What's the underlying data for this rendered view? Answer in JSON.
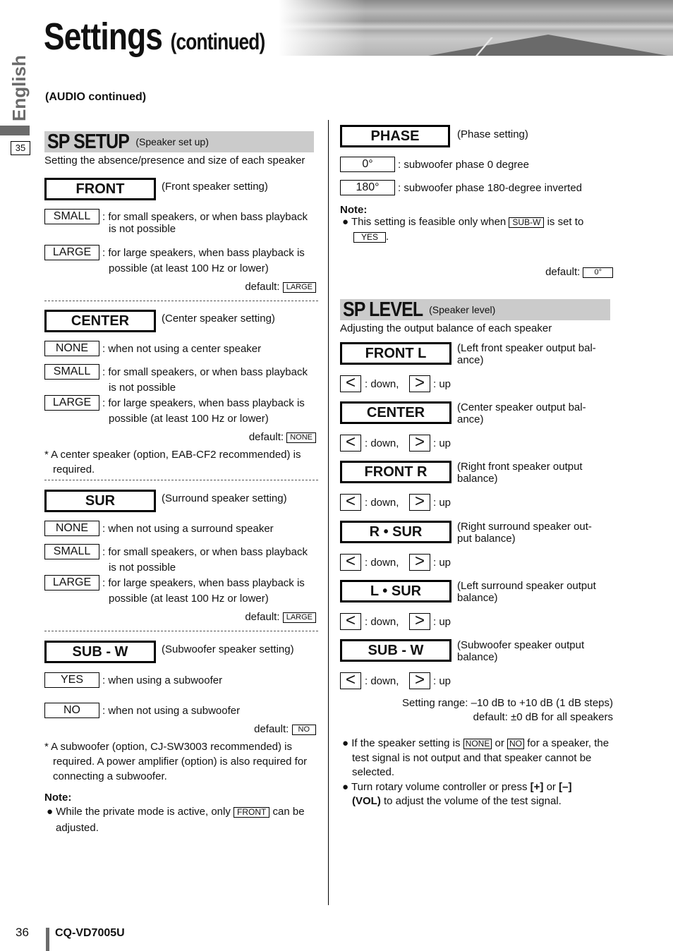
{
  "header": {
    "title": "Settings",
    "title_suffix": "(continued)",
    "side_tab_label": "English",
    "side_tab_page": "35",
    "subheading": "(AUDIO continued)"
  },
  "sp_setup": {
    "title": "SP SETUP",
    "subtitle": "(Speaker set up)",
    "description": "Setting the absence/presence and size of each speaker",
    "groups": [
      {
        "name": "FRONT",
        "note": "(Front speaker setting)",
        "options": [
          {
            "value": "SMALL",
            "desc": [
              ": for small speakers, or when bass playback",
              "is not possible"
            ]
          },
          {
            "value": "LARGE",
            "desc": [
              ": for large speakers, when bass playback is",
              "possible (at least 100 Hz or lower)"
            ]
          }
        ],
        "default_label": "default:",
        "default_value": "LARGE"
      },
      {
        "name": "CENTER",
        "note": "(Center speaker setting)",
        "options": [
          {
            "value": "NONE",
            "desc": [
              ": when not using a center speaker"
            ]
          },
          {
            "value": "SMALL",
            "desc": [
              ": for small speakers, or when bass playback",
              "is not possible"
            ]
          },
          {
            "value": "LARGE",
            "desc": [
              ": for large speakers, when bass playback is",
              "possible (at least 100 Hz or lower)"
            ]
          }
        ],
        "default_label": "default:",
        "default_value": "NONE",
        "footnote": [
          "* A center speaker (option, EAB-CF2 recommended) is",
          "required."
        ]
      },
      {
        "name": "SUR",
        "note": "(Surround speaker setting)",
        "options": [
          {
            "value": "NONE",
            "desc": [
              ": when not using a surround speaker"
            ]
          },
          {
            "value": "SMALL",
            "desc": [
              ": for small speakers, or when bass playback",
              "is not possible"
            ]
          },
          {
            "value": "LARGE",
            "desc": [
              ": for large speakers, when bass playback is",
              "possible (at least 100 Hz or lower)"
            ]
          }
        ],
        "default_label": "default:",
        "default_value": "LARGE"
      },
      {
        "name": "SUB - W",
        "note": "(Subwoofer speaker setting)",
        "options": [
          {
            "value": "YES",
            "desc": [
              ": when using a subwoofer"
            ]
          },
          {
            "value": "NO",
            "desc": [
              ": when not using a subwoofer"
            ]
          }
        ],
        "default_label": "default:",
        "default_value": "NO",
        "footnote": [
          "* A subwoofer (option, CJ-SW3003 recommended) is",
          "required. A power amplifier (option) is also required for",
          "connecting a subwoofer."
        ]
      }
    ],
    "note_heading": "Note:",
    "note_pre": "While the private mode is active, only",
    "note_box": "FRONT",
    "note_post": "can be",
    "note_line2": "adjusted."
  },
  "phase": {
    "name": "PHASE",
    "note": "(Phase setting)",
    "options": [
      {
        "value": "0°",
        "desc": ": subwoofer phase 0 degree"
      },
      {
        "value": "180°",
        "desc": ": subwoofer phase 180-degree inverted"
      }
    ],
    "note_heading": "Note:",
    "note_pre": "This setting is feasible only when",
    "note_box1": "SUB-W",
    "note_mid": "is set to",
    "note_box2": "YES",
    "note_end": ".",
    "default_label": "default:",
    "default_value": "0°"
  },
  "sp_level": {
    "title": "SP LEVEL",
    "subtitle": "(Speaker level)",
    "description": "Adjusting the output balance of each speaker",
    "down_icon": "<",
    "up_icon": ">",
    "down_label": ": down,",
    "up_label": ": up",
    "speakers": [
      {
        "name": "FRONT L",
        "note": [
          "(Left front speaker output bal-",
          "ance)"
        ]
      },
      {
        "name": "CENTER",
        "note": [
          "(Center speaker output bal-",
          "ance)"
        ]
      },
      {
        "name": "FRONT R",
        "note": [
          "(Right front speaker output",
          "balance)"
        ]
      },
      {
        "name": "R • SUR",
        "note": [
          "(Right surround speaker out-",
          "put balance)"
        ]
      },
      {
        "name": "L • SUR",
        "note": [
          "(Left surround speaker output",
          "balance)"
        ]
      },
      {
        "name": "SUB - W",
        "note": [
          "(Subwoofer speaker output",
          "balance)"
        ]
      }
    ],
    "range_text": "Setting range: –10 dB to +10 dB (1 dB steps)",
    "default_text": "default: ±0 dB for all speakers",
    "bullet1_pre": "If the speaker setting is",
    "bullet1_box1": "NONE",
    "bullet1_mid": "or",
    "bullet1_box2": "NO",
    "bullet1_post": "for a speaker, the",
    "bullet1_line2": "test signal is not output and that speaker cannot be",
    "bullet1_line3": "selected.",
    "bullet2_pre": "Turn rotary volume controller or press",
    "bullet2_b1": "[+]",
    "bullet2_mid": "or",
    "bullet2_b2": "[–]",
    "bullet2_b3": "(VOL)",
    "bullet2_post": "to adjust the volume of the test signal."
  },
  "footer": {
    "page_number": "36",
    "model": "CQ-VD7005U"
  }
}
